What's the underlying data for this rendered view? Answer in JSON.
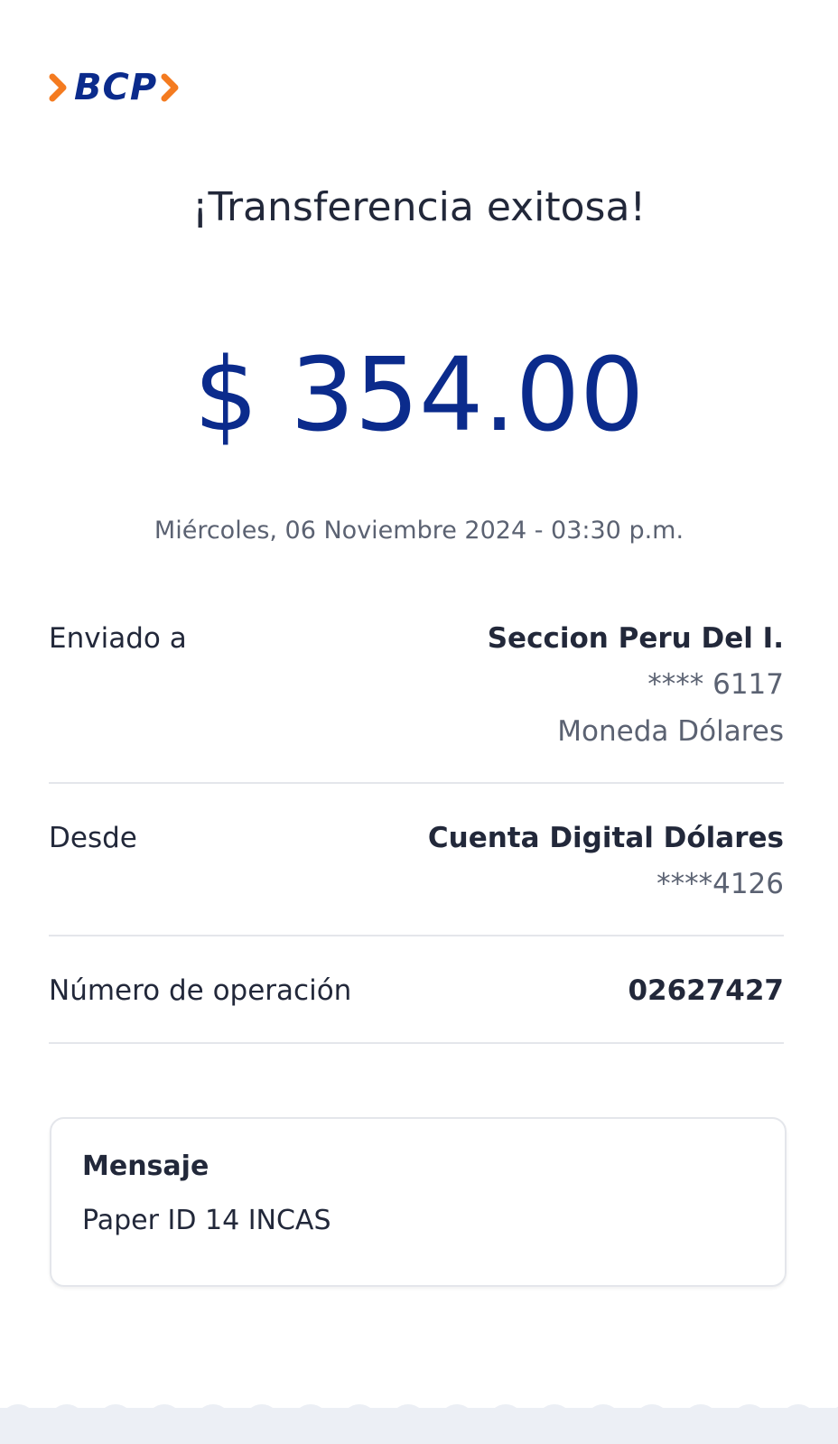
{
  "colors": {
    "brand_blue": "#0b2b8c",
    "brand_orange": "#f47b20",
    "amount_blue": "#0b2b8c",
    "text_dark": "#22283a",
    "text_muted": "#5b6272",
    "divider": "#e4e6eb",
    "footer_bg": "#eceff5"
  },
  "logo": {
    "text": "BCP",
    "left_icon": "chevron-right-orange",
    "right_icon": "chevron-right-orange"
  },
  "header": {
    "title": "¡Transferencia exitosa!"
  },
  "transfer": {
    "amount": "$ 354.00",
    "datetime": "Miércoles, 06 Noviembre 2024 - 03:30 p.m."
  },
  "details": {
    "sent_to": {
      "label": "Enviado a",
      "name": "Seccion Peru Del I.",
      "account": "**** 6117",
      "currency": "Moneda Dólares"
    },
    "from": {
      "label": "Desde",
      "account_name": "Cuenta Digital Dólares",
      "account": "****4126"
    },
    "operation": {
      "label": "Número de operación",
      "number": "02627427"
    }
  },
  "message": {
    "title": "Mensaje",
    "text": "Paper ID 14 INCAS"
  }
}
